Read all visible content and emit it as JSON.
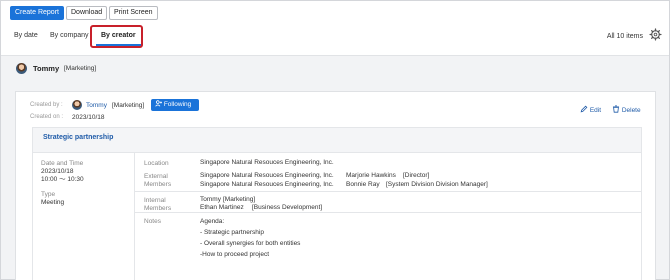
{
  "toolbar": {
    "create_report": "Create Report",
    "download": "Download",
    "print_screen": "Print Screen"
  },
  "tabs": [
    {
      "label": "By date"
    },
    {
      "label": "By company"
    },
    {
      "label": "By creator"
    }
  ],
  "items_count": "All 10 items",
  "user_filter": {
    "name": "Tommy",
    "dept": "[Marketing]"
  },
  "report": {
    "created_by_label": "Created by :",
    "created_by_name": "Tommy",
    "created_by_dept": "[Marketing]",
    "following_label": "Following",
    "created_on_label": "Created on :",
    "created_on_value": "2023/10/18",
    "edit_label": "Edit",
    "delete_label": "Delete",
    "title": "Strategic partnership",
    "date_time_label": "Date and Time",
    "date_value": "2023/10/18",
    "time_value": "10:00 〜 10:30",
    "type_label": "Type",
    "type_value": "Meeting",
    "location_label": "Location",
    "location_value": "Singapore Natural Resouces Engineering, Inc.",
    "external_label_1": "External",
    "external_label_2": "Members",
    "external_members": [
      {
        "company": "Singapore Natural Resouces Engineering, Inc.",
        "person": "Marjorie Hawkins",
        "role": "[Director]"
      },
      {
        "company": "Singapore Natural Resouces Engineering, Inc.",
        "person": "Bonnie Ray",
        "role": "[System Division Division Manager]"
      }
    ],
    "internal_label_1": "Internal",
    "internal_label_2": "Members",
    "internal_members": [
      {
        "person": "Tommy",
        "role": "[Marketing]"
      },
      {
        "person": "Ethan Martinez",
        "role": "[Business Development]"
      }
    ],
    "notes_label": "Notes",
    "notes_lines": [
      "Agenda:",
      "- Strategic partnership",
      "- Overall synergies for both entities",
      "-How to proceed project"
    ]
  },
  "colors": {
    "accent": "#1a73d9",
    "highlight": "#c8202a",
    "link": "#1f5ba8"
  }
}
